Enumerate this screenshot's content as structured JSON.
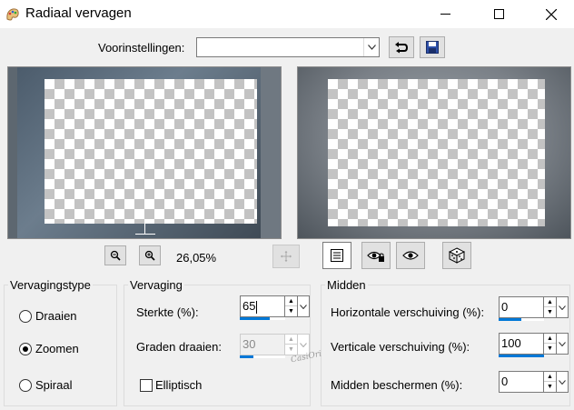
{
  "window": {
    "title": "Radiaal vervagen",
    "icons": {
      "app": "palette-icon",
      "minimize": "minimize-icon",
      "maximize": "maximize-icon",
      "close": "close-icon"
    }
  },
  "presets": {
    "label": "Voorinstellingen:",
    "value": "",
    "undo_icon": "undo-icon",
    "save_icon": "save-icon"
  },
  "zoom": {
    "level": "26,05%",
    "out_icon": "zoom-out-icon",
    "in_icon": "zoom-in-icon",
    "move_icon": "move-icon"
  },
  "view_tools": [
    "view-list-icon",
    "proof-lock-icon",
    "eye-icon",
    "dice-icon"
  ],
  "blur_type": {
    "title": "Vervagingstype",
    "options": [
      {
        "label": "Draaien",
        "selected": false
      },
      {
        "label": "Zoomen",
        "selected": true
      },
      {
        "label": "Spiraal",
        "selected": false
      }
    ]
  },
  "blur": {
    "title": "Vervaging",
    "strength_label": "Sterkte (%):",
    "strength_value": "65",
    "strength_fill": 0.65,
    "rotate_label": "Graden draaien:",
    "rotate_value": "30",
    "rotate_enabled": false,
    "elliptic_label": "Elliptisch",
    "elliptic_checked": false
  },
  "center": {
    "title": "Midden",
    "h_offset_label": "Horizontale verschuiving (%):",
    "h_offset_value": "0",
    "h_offset_fill": 0.5,
    "v_offset_label": "Verticale verschuiving (%):",
    "v_offset_value": "100",
    "v_offset_fill": 1.0,
    "protect_label": "Midden beschermen (%):",
    "protect_value": "0"
  },
  "watermark_text": "CasiOri"
}
